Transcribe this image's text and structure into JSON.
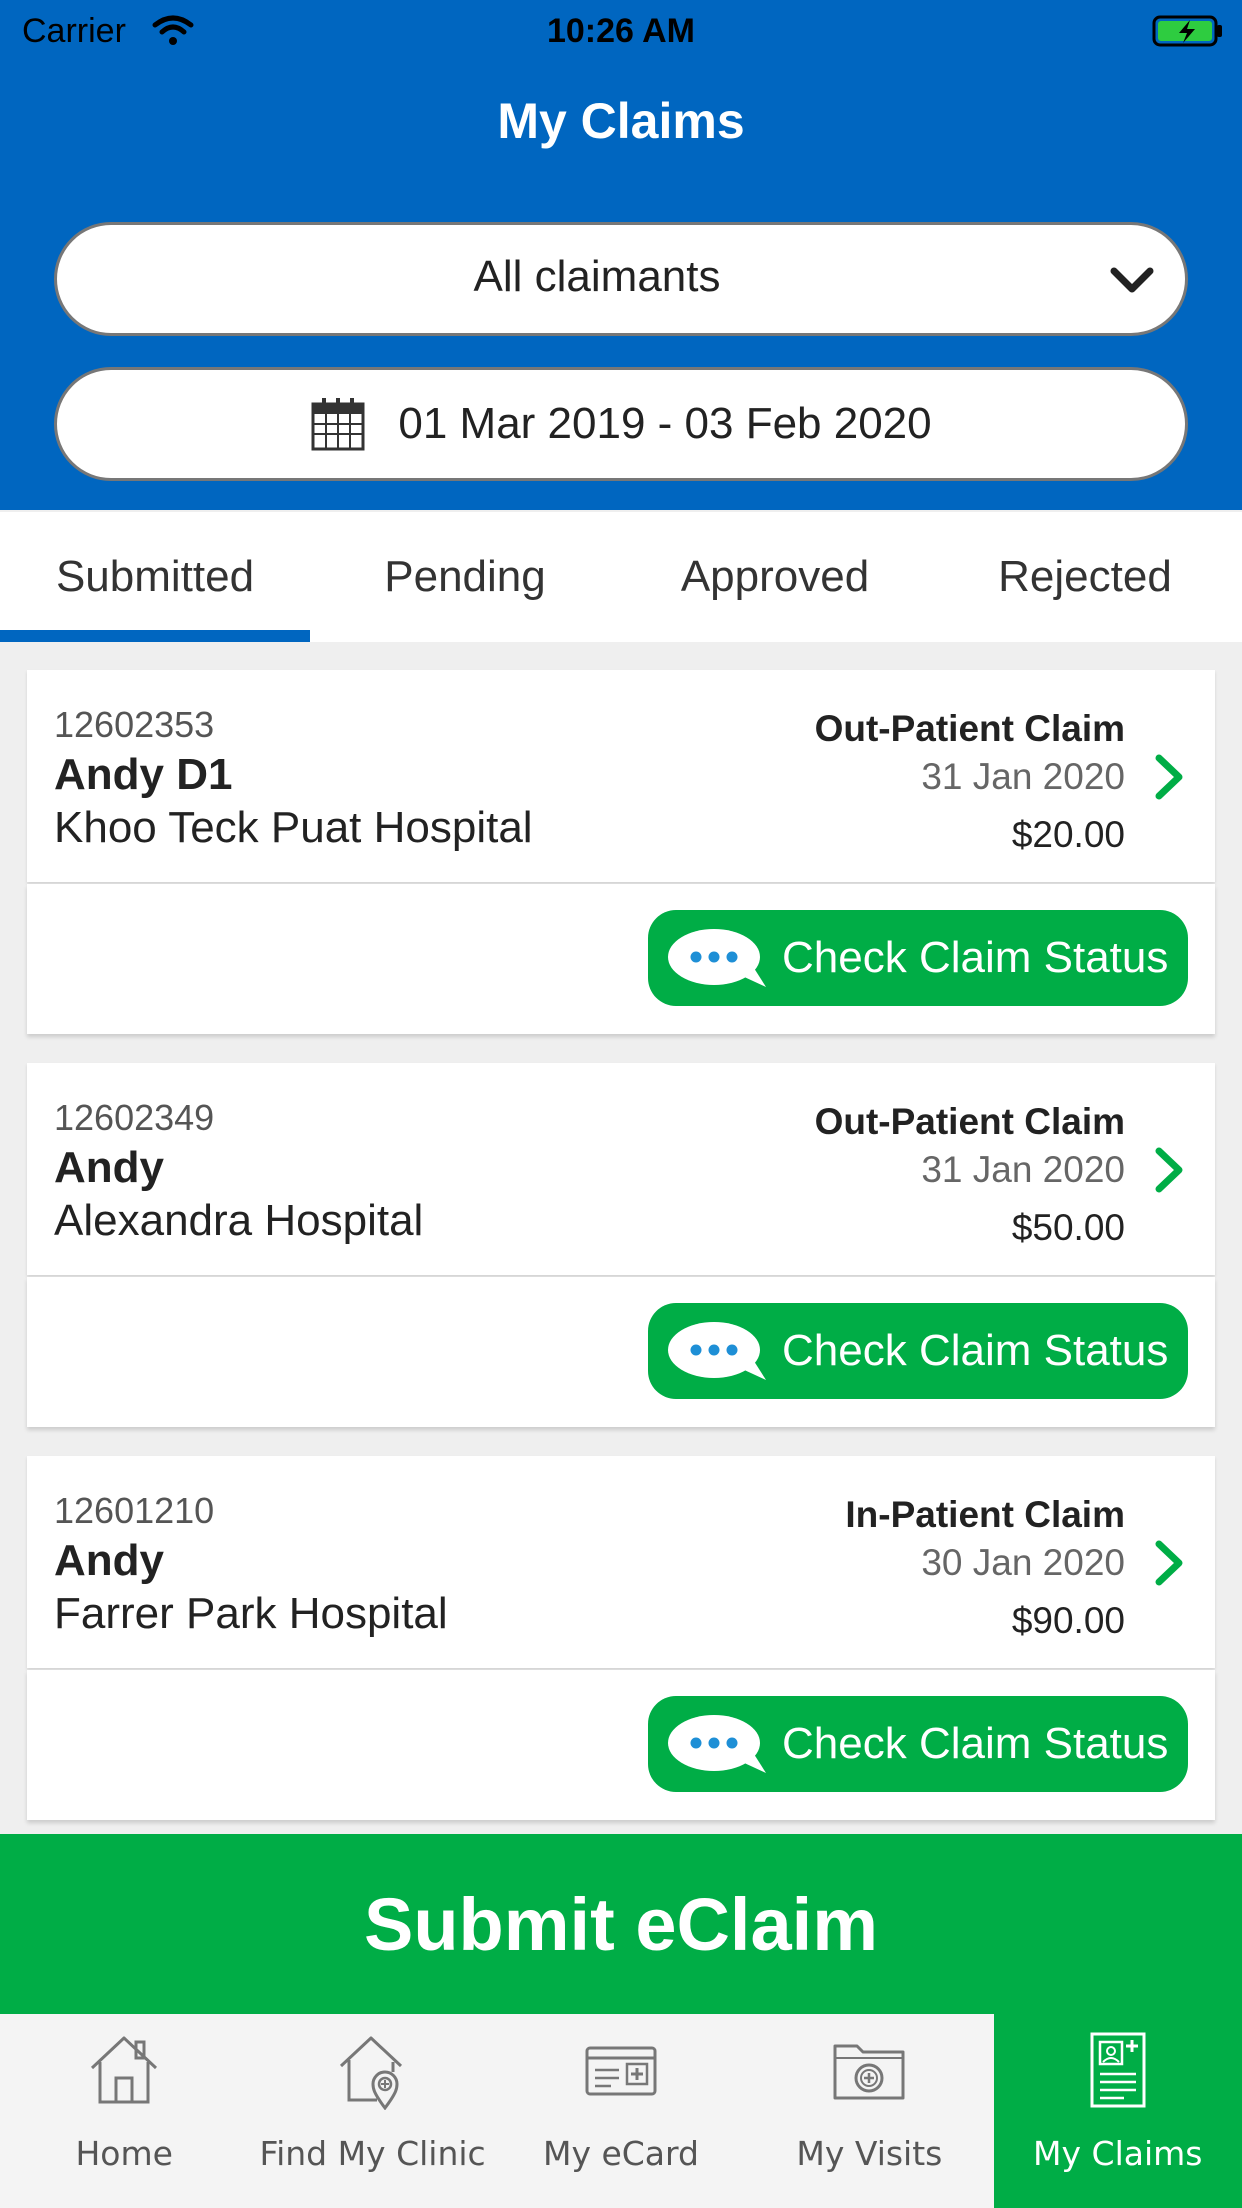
{
  "status_bar": {
    "carrier": "Carrier",
    "time": "10:26 AM"
  },
  "header": {
    "title": "My Claims",
    "claimant_filter": "All claimants",
    "date_range": "01 Mar 2019 - 03 Feb 2020"
  },
  "tabs": [
    {
      "label": "Submitted",
      "active": true
    },
    {
      "label": "Pending"
    },
    {
      "label": "Approved"
    },
    {
      "label": "Rejected"
    }
  ],
  "claims": [
    {
      "id": "12602353",
      "name": "Andy D1",
      "hospital": "Khoo Teck Puat Hospital",
      "type": "Out-Patient Claim",
      "date": "31 Jan 2020",
      "amount": "$20.00",
      "action": "Check Claim Status"
    },
    {
      "id": "12602349",
      "name": "Andy",
      "hospital": "Alexandra Hospital",
      "type": "Out-Patient Claim",
      "date": "31 Jan 2020",
      "amount": "$50.00",
      "action": "Check Claim Status"
    },
    {
      "id": "12601210",
      "name": "Andy",
      "hospital": "Farrer Park Hospital",
      "type": "In-Patient Claim",
      "date": "30 Jan 2020",
      "amount": "$90.00",
      "action": "Check Claim Status"
    }
  ],
  "submit": {
    "label": "Submit eClaim"
  },
  "bottom_nav": [
    {
      "label": "Home",
      "icon": "home-icon"
    },
    {
      "label": "Find My Clinic",
      "icon": "clinic-location-icon"
    },
    {
      "label": "My eCard",
      "icon": "ecard-icon"
    },
    {
      "label": "My Visits",
      "icon": "visits-folder-icon"
    },
    {
      "label": "My Claims",
      "icon": "claims-document-icon",
      "active": true
    }
  ],
  "colors": {
    "primary_blue": "#0066c0",
    "accent_green": "#00ad46",
    "background": "#efefef"
  }
}
